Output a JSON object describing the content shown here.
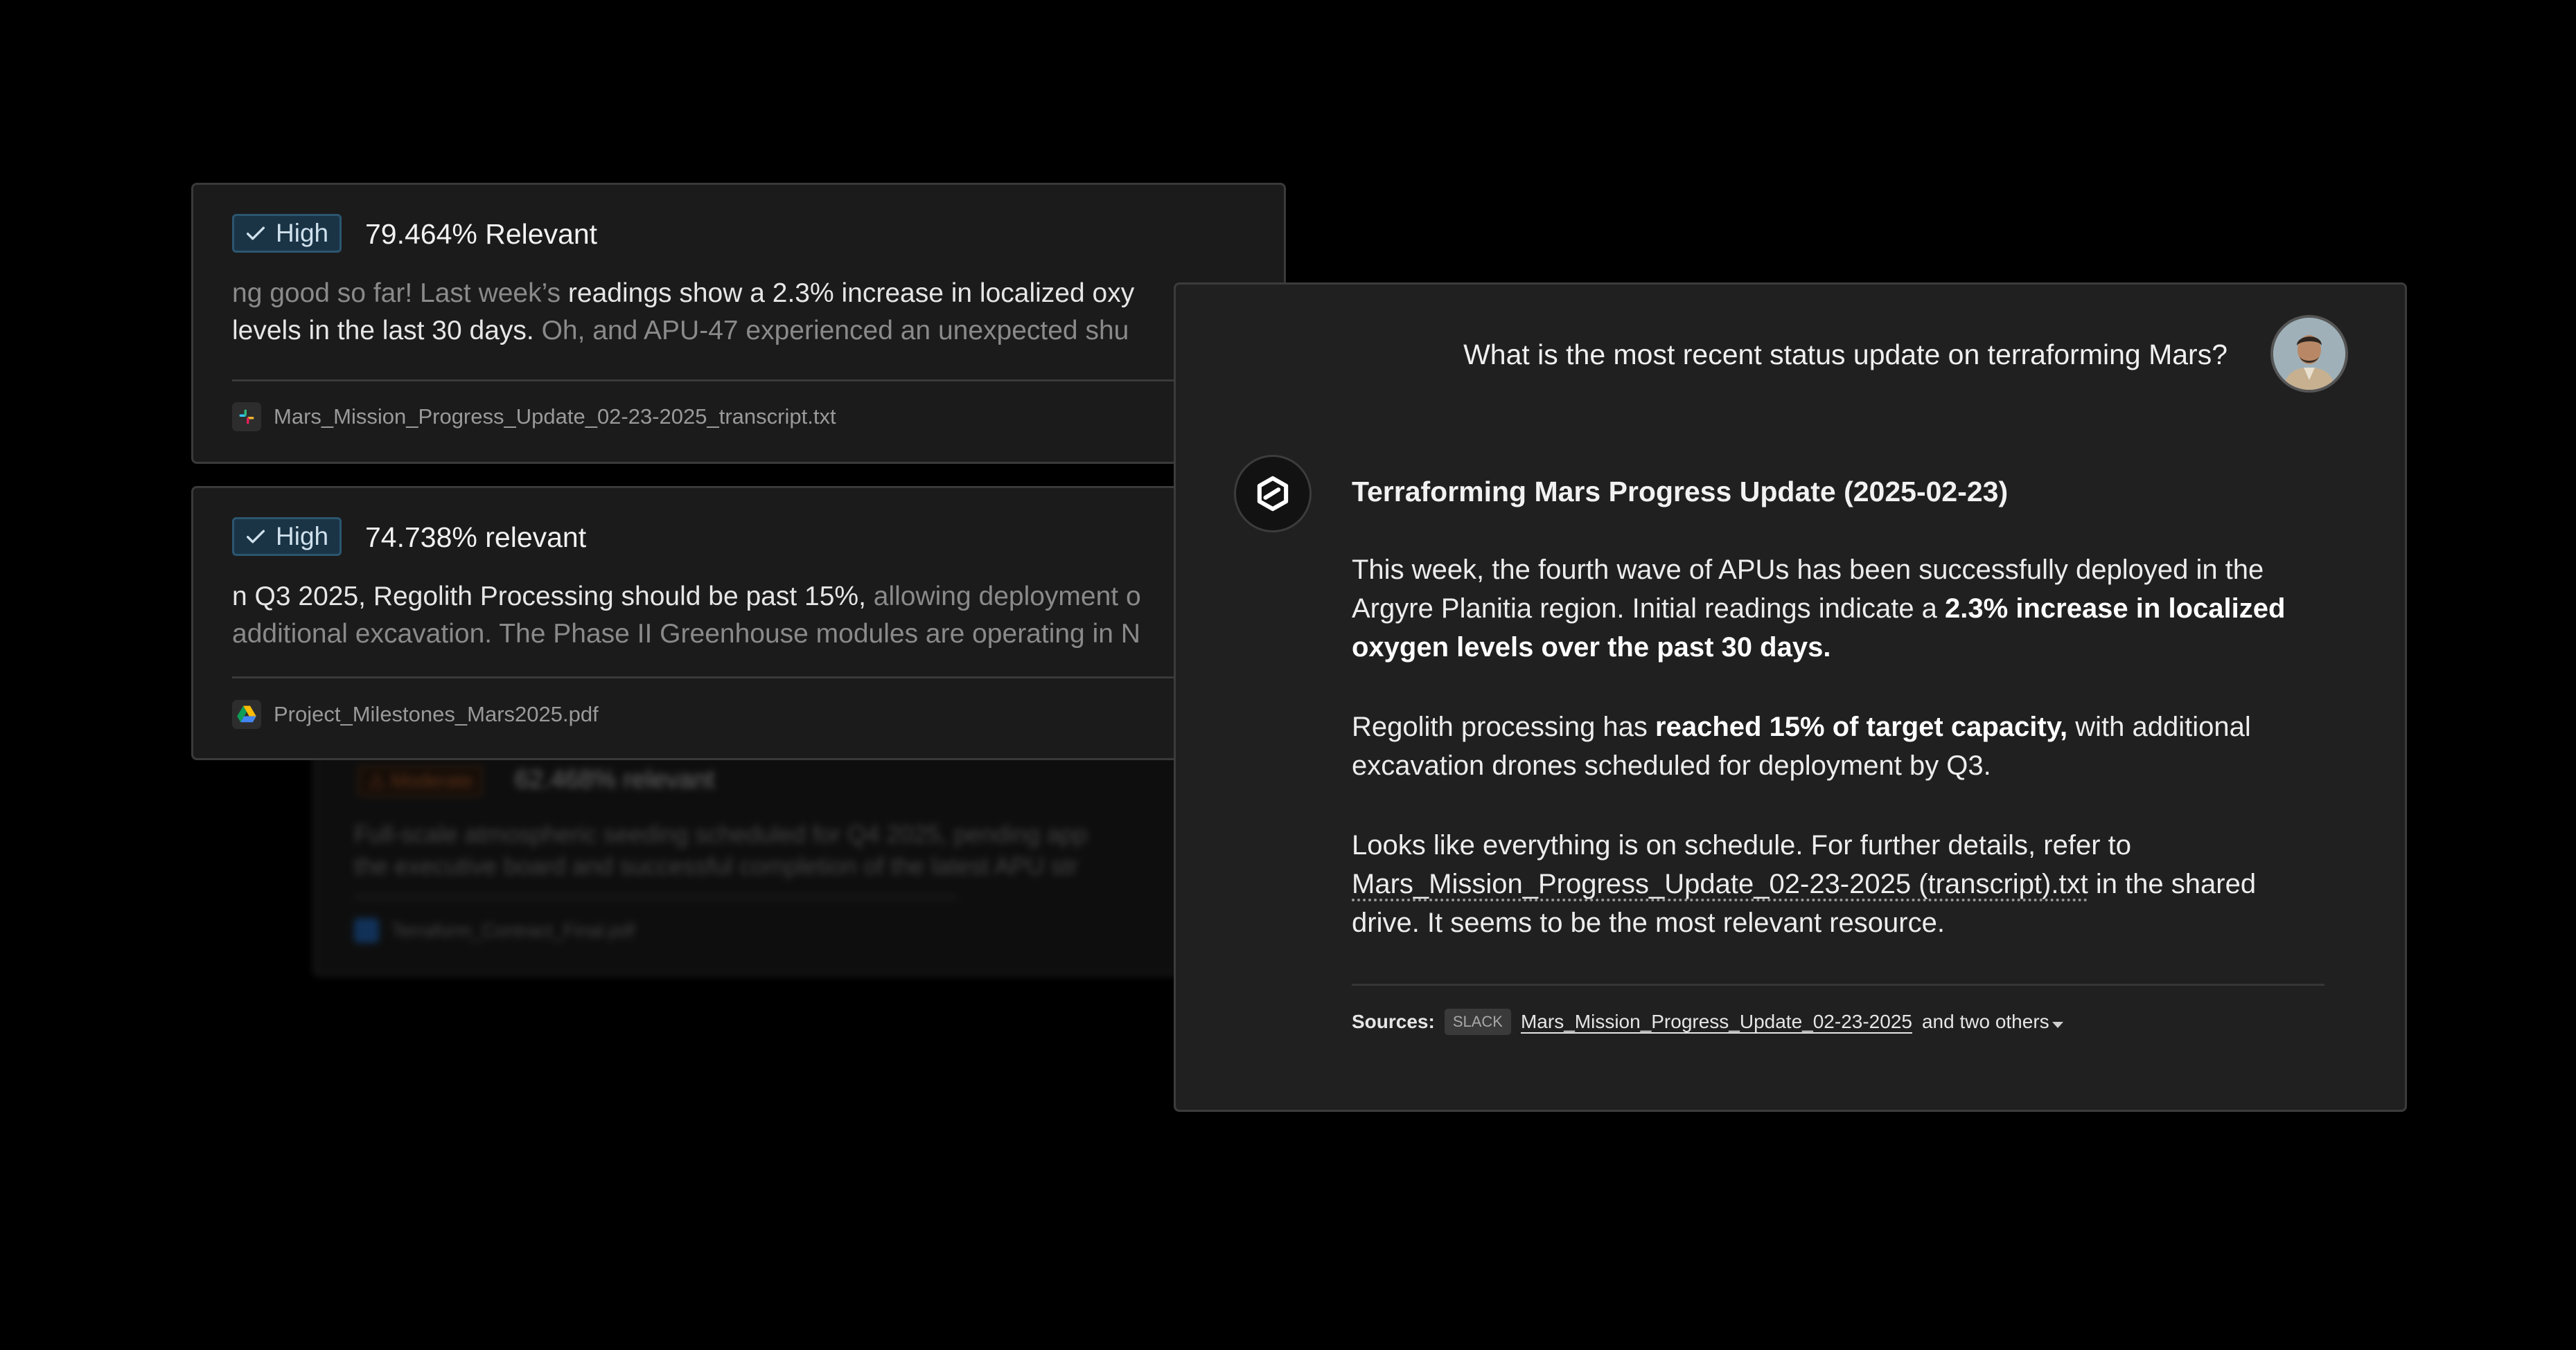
{
  "results": [
    {
      "badge": "High",
      "relevance": "79.464% Relevant",
      "snippet_line1": [
        {
          "text": "ng good so far! Last week’s ",
          "emph": false
        },
        {
          "text": "readings show a 2.3% increase in localized oxy",
          "emph": true
        }
      ],
      "snippet_line2": [
        {
          "text": "levels in the last 30 days.",
          "emph": true
        },
        {
          "text": " Oh, and APU-47 experienced an unexpected shu",
          "emph": false
        }
      ],
      "file_name": "Mars_Mission_Progress_Update_02-23-2025_transcript.txt",
      "file_icon": "slack-icon"
    },
    {
      "badge": "High",
      "relevance": "74.738% relevant",
      "snippet_line1": [
        {
          "text": "n Q3 2025, Regolith Processing should be past 15%,",
          "emph": true
        },
        {
          "text": " allowing deployment o",
          "emph": false
        }
      ],
      "snippet_line2": [
        {
          "text": "additional excavation. The Phase II Greenhouse modules are operating in N",
          "emph": false
        }
      ],
      "file_name": "Project_Milestones_Mars2025.pdf",
      "file_icon": "google-drive-icon"
    },
    {
      "badge": "Moderate",
      "relevance": "62.468% relevant",
      "snippet_line1": [
        {
          "text": "Full-scale atmospheric seeding scheduled for Q4 2025, pending app",
          "emph": false
        }
      ],
      "snippet_line2": [
        {
          "text": "the executive board and successful completion of the latest APU str",
          "emph": false
        }
      ],
      "file_name": "Terraform_Contract_Final.pdf",
      "file_icon": "document-icon"
    }
  ],
  "chat": {
    "question": "What is the most recent status update on terraforming Mars?",
    "answer_title": "Terraforming Mars Progress Update (2025-02-23)",
    "paragraphs": [
      [
        [
          {
            "text": "This week, the fourth wave of APUs has been successfully deployed in the",
            "style": "normal"
          }
        ],
        [
          {
            "text": "Argyre Planitia region. Initial readings indicate a ",
            "style": "normal"
          },
          {
            "text": "2.3% increase in localized",
            "style": "bold"
          }
        ],
        [
          {
            "text": "oxygen levels over the past 30 days.",
            "style": "bold"
          }
        ]
      ],
      [
        [
          {
            "text": "Regolith processing has ",
            "style": "normal"
          },
          {
            "text": "reached 15% of target capacity,",
            "style": "bold"
          },
          {
            "text": " with additional",
            "style": "normal"
          }
        ],
        [
          {
            "text": "excavation drones scheduled for deployment by Q3.",
            "style": "normal"
          }
        ]
      ],
      [
        [
          {
            "text": "Looks like everything is on schedule. For further details, refer to",
            "style": "normal"
          }
        ],
        [
          {
            "text": "Mars_Mission_Progress_Update_02-23-2025 (transcript).txt",
            "style": "link"
          },
          {
            "text": " in the shared",
            "style": "normal"
          }
        ],
        [
          {
            "text": "drive. It seems to be the most relevant resource.",
            "style": "normal"
          }
        ]
      ]
    ],
    "sources_label": "Sources:",
    "source_tag": "SLACK",
    "source_link": "Mars_Mission_Progress_Update_02-23-2025",
    "source_more": "and two others"
  }
}
